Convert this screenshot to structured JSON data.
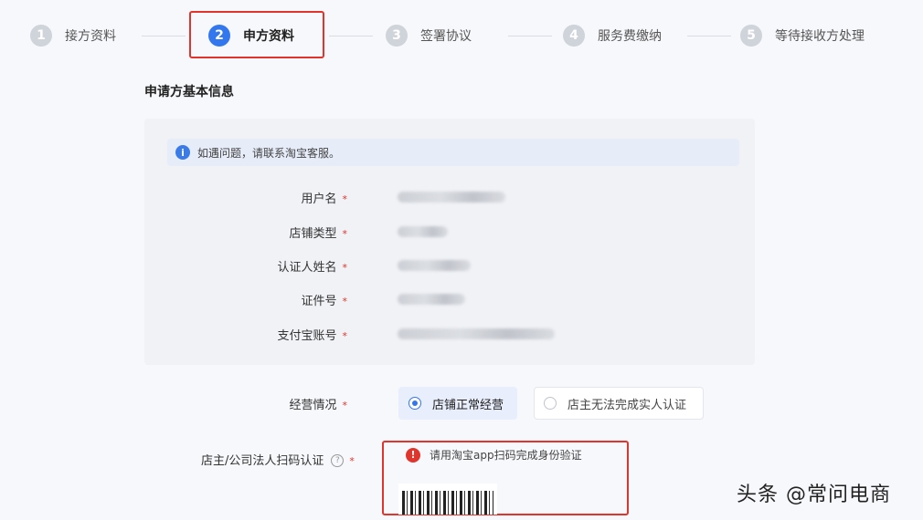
{
  "steps": [
    {
      "num": "1",
      "label": "接方资料"
    },
    {
      "num": "2",
      "label": "申方资料"
    },
    {
      "num": "3",
      "label": "签署协议"
    },
    {
      "num": "4",
      "label": "服务费缴纳"
    },
    {
      "num": "5",
      "label": "等待接收方处理"
    }
  ],
  "colors": {
    "accent": "#3377ee",
    "highlight": "#e0342d",
    "error": "#e0342d"
  },
  "section_title": "申请方基本信息",
  "notice": {
    "icon": "info-icon",
    "text": "如遇问题，请联系淘宝客服。"
  },
  "fields": [
    {
      "label": "用户名"
    },
    {
      "label": "店铺类型"
    },
    {
      "label": "认证人姓名"
    },
    {
      "label": "证件号"
    },
    {
      "label": "支付宝账号"
    }
  ],
  "required_mark": "*",
  "business_status": {
    "label": "经营情况",
    "options": [
      {
        "label": "店铺正常经营",
        "selected": true
      },
      {
        "label": "店主无法完成实人认证",
        "selected": false
      }
    ]
  },
  "scan": {
    "label": "店主/公司法人扫码认证",
    "help_icon": "question-circle-icon",
    "help_glyph": "?",
    "error_icon": "error-circle-icon",
    "error_glyph": "!",
    "error_text": "请用淘宝app扫码完成身份验证"
  },
  "watermark": "头条 @常问电商"
}
